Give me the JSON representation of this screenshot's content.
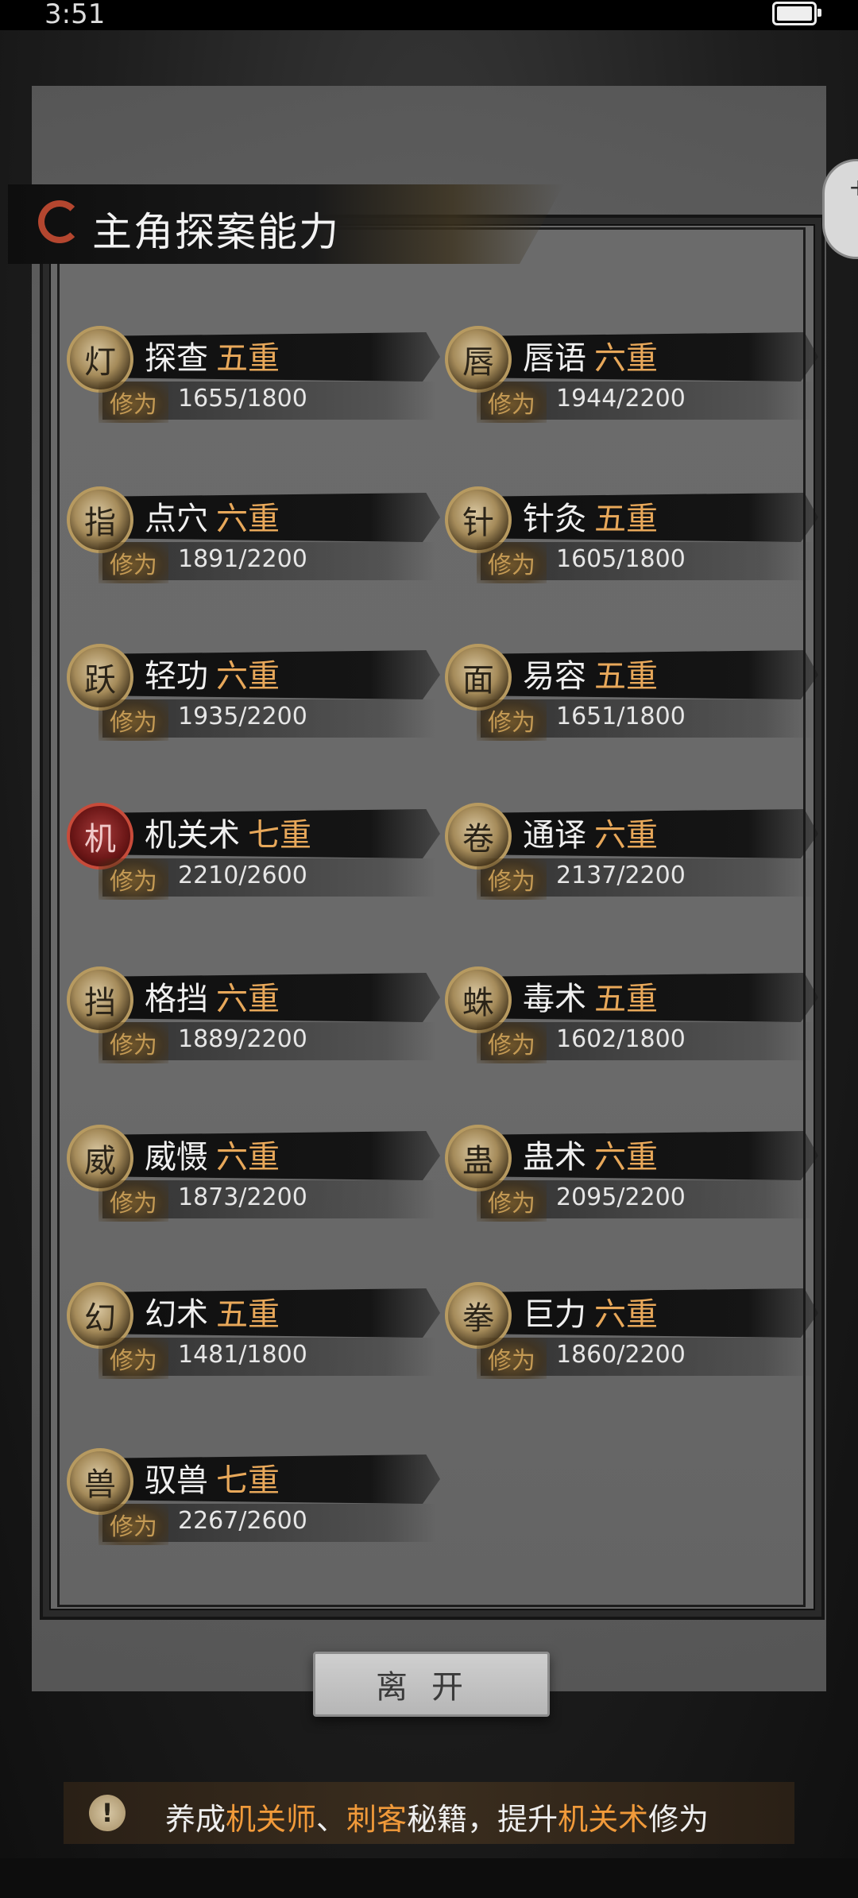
{
  "status_bar": {
    "time": "3:51",
    "battery_level": 1.0
  },
  "title": "主角探案能力",
  "xp_label": "修为",
  "skills": [
    {
      "name": "探查",
      "level": "五重",
      "xp": "1655/1800",
      "icon": "lantern-icon"
    },
    {
      "name": "唇语",
      "level": "六重",
      "xp": "1944/2200",
      "icon": "lips-icon"
    },
    {
      "name": "点穴",
      "level": "六重",
      "xp": "1891/2200",
      "icon": "pressure-point-icon"
    },
    {
      "name": "针灸",
      "level": "五重",
      "xp": "1605/1800",
      "icon": "needle-icon"
    },
    {
      "name": "轻功",
      "level": "六重",
      "xp": "1935/2200",
      "icon": "leap-icon"
    },
    {
      "name": "易容",
      "level": "五重",
      "xp": "1651/1800",
      "icon": "mask-icon"
    },
    {
      "name": "机关术",
      "level": "七重",
      "xp": "2210/2600",
      "icon": "mechanism-icon"
    },
    {
      "name": "通译",
      "level": "六重",
      "xp": "2137/2200",
      "icon": "scroll-icon"
    },
    {
      "name": "格挡",
      "level": "六重",
      "xp": "1889/2200",
      "icon": "block-icon"
    },
    {
      "name": "毒术",
      "level": "五重",
      "xp": "1602/1800",
      "icon": "spider-icon"
    },
    {
      "name": "威慑",
      "level": "六重",
      "xp": "1873/2200",
      "icon": "intimidate-icon"
    },
    {
      "name": "蛊术",
      "level": "六重",
      "xp": "2095/2200",
      "icon": "larva-icon"
    },
    {
      "name": "幻术",
      "level": "五重",
      "xp": "1481/1800",
      "icon": "hooded-figure-icon"
    },
    {
      "name": "巨力",
      "level": "六重",
      "xp": "1860/2200",
      "icon": "fist-icon"
    },
    {
      "name": "驭兽",
      "level": "七重",
      "xp": "2267/2600",
      "icon": "wolf-icon"
    }
  ],
  "leave_button": "离开",
  "tip": {
    "prefix": "养成",
    "hl1": "机关师",
    "sep": "、",
    "hl2": "刺客",
    "mid": "秘籍，提升",
    "hl3": "机关术",
    "suffix": "修为"
  },
  "colors": {
    "level": "#e8a85a",
    "highlight": "#f19a3a",
    "xp_label": "#c49a54"
  }
}
